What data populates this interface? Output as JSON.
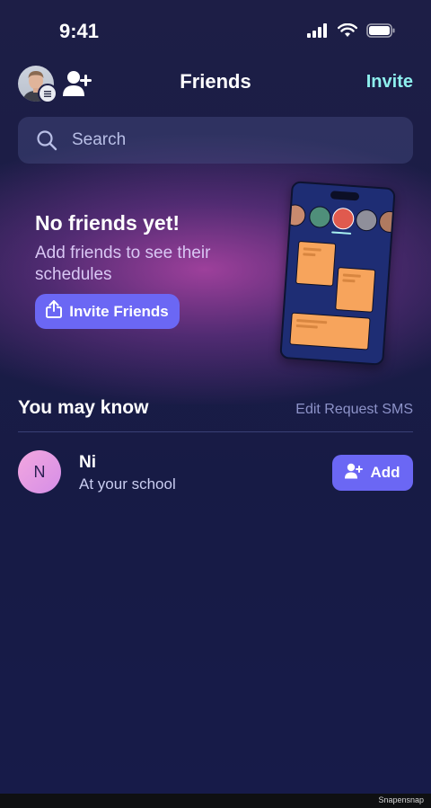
{
  "status_bar": {
    "time": "9:41"
  },
  "header": {
    "title": "Friends",
    "invite_label": "Invite"
  },
  "search": {
    "placeholder": "Search"
  },
  "empty_state": {
    "title": "No friends yet!",
    "subtitle": "Add friends to see their schedules",
    "button_label": "Invite Friends"
  },
  "suggestions": {
    "title": "You may know",
    "edit_sms_label": "Edit Request SMS",
    "items": [
      {
        "initial": "N",
        "name": "Ni",
        "subtitle": "At your school",
        "add_label": "Add"
      }
    ]
  },
  "footer": {
    "watermark": "Snapensnap"
  },
  "colors": {
    "accent_button": "#6b67f4",
    "invite_link": "#8ef0ee",
    "background": "#1a1c46",
    "card_orange": "#f7a45c"
  }
}
